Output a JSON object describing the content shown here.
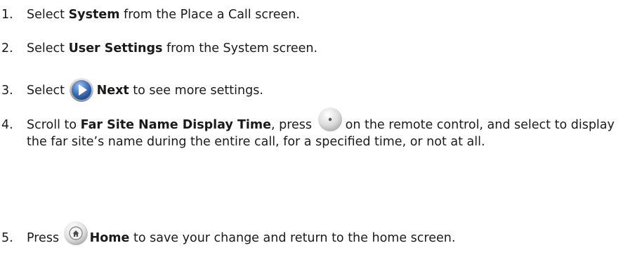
{
  "steps": [
    {
      "number": "1.",
      "before": "Select ",
      "bold": "System",
      "after": " from the Place a Call screen."
    },
    {
      "number": "2.",
      "before": "Select ",
      "bold": "User Settings",
      "after": " from the System screen."
    },
    {
      "number": "3.",
      "before": "Select ",
      "icon": "next-arrow-icon",
      "bold": "Next",
      "after": " to see more settings."
    },
    {
      "number": "4.",
      "before": "Scroll to ",
      "bold": "Far Site Name Display Time",
      "middle": ", press ",
      "icon": "select-button-icon",
      "after": "on the remote control, and select to display the far site’s name during the entire call, for a specified time, or not at all."
    },
    {
      "number": "5.",
      "before": "Press ",
      "icon": "home-button-icon",
      "bold": "Home",
      "after": " to save your change and return to the home screen."
    }
  ],
  "colors": {
    "text": "#1a1a1a",
    "icon_blue": "#2c5fa8",
    "icon_gray": "#c9c9c9"
  }
}
